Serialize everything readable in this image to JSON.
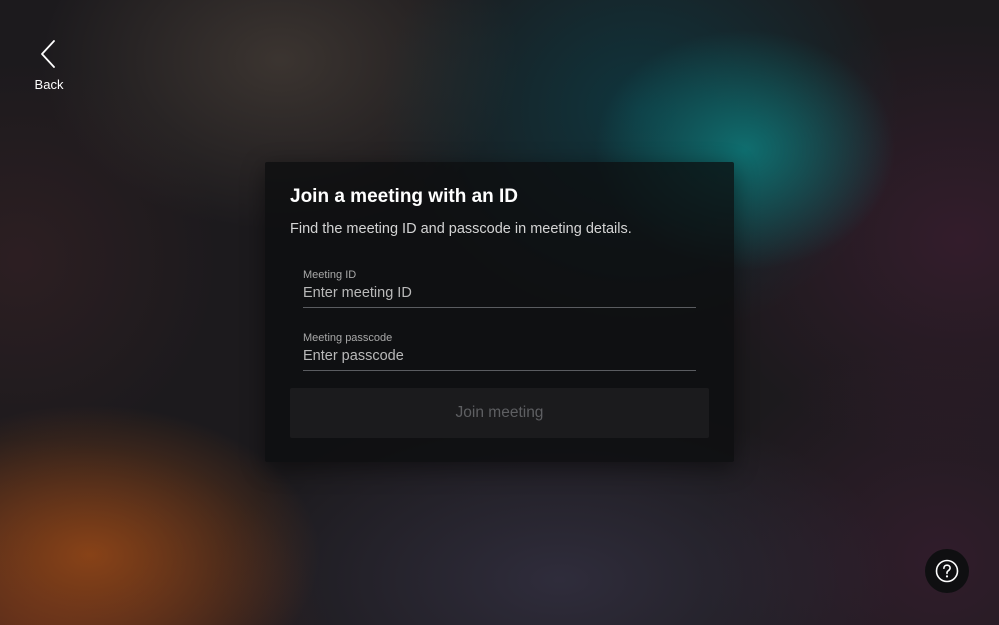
{
  "nav": {
    "back_label": "Back",
    "back_icon": "chevron-left-icon"
  },
  "card": {
    "title": "Join a meeting with an ID",
    "subtitle": "Find the meeting ID and passcode in meeting details.",
    "meeting_id": {
      "label": "Meeting ID",
      "placeholder": "Enter meeting ID",
      "value": ""
    },
    "passcode": {
      "label": "Meeting passcode",
      "placeholder": "Enter passcode",
      "value": ""
    },
    "join_label": "Join meeting",
    "join_enabled": false
  },
  "help": {
    "icon": "question-circle-icon"
  },
  "colors": {
    "card_background": "#0c0d0f",
    "text_primary": "#ffffff",
    "text_secondary": "#d4d4d4",
    "button_disabled_bg": "#1b1b1d",
    "button_disabled_text": "#5e5f62",
    "field_underline": "#5a5c60"
  }
}
